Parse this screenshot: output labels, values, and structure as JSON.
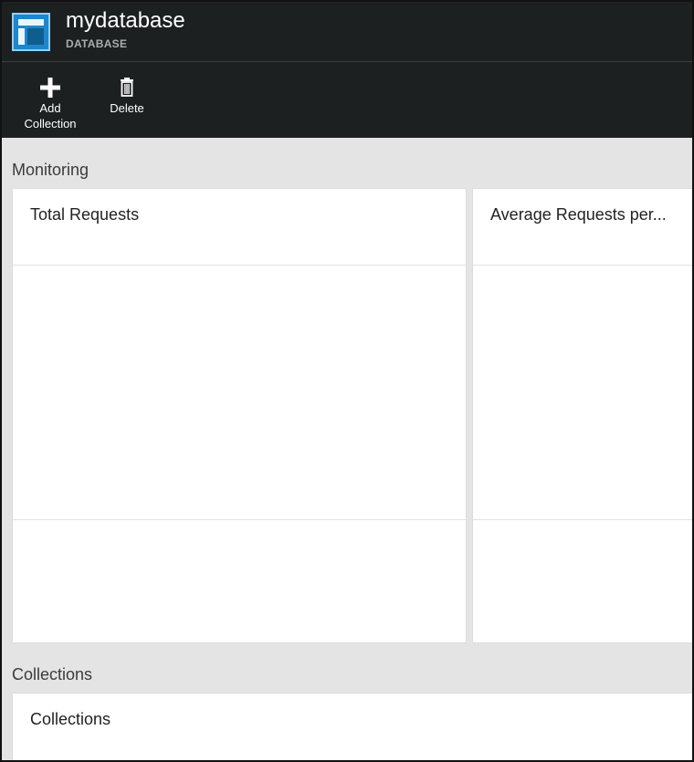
{
  "header": {
    "icon": "database-blade-icon",
    "title": "mydatabase",
    "subtitle": "DATABASE"
  },
  "toolbar": {
    "add_collection": {
      "icon": "plus-icon",
      "label_line1": "Add",
      "label_line2": "Collection"
    },
    "delete": {
      "icon": "trash-icon",
      "label": "Delete"
    }
  },
  "monitoring": {
    "heading": "Monitoring",
    "tiles": [
      {
        "title": "Total Requests"
      },
      {
        "title": "Average Requests per..."
      }
    ]
  },
  "collections": {
    "heading": "Collections",
    "tile_title": "Collections"
  },
  "colors": {
    "header_bg": "#1d2021",
    "accent": "#1f86c9",
    "page_bg": "#e4e4e4"
  }
}
